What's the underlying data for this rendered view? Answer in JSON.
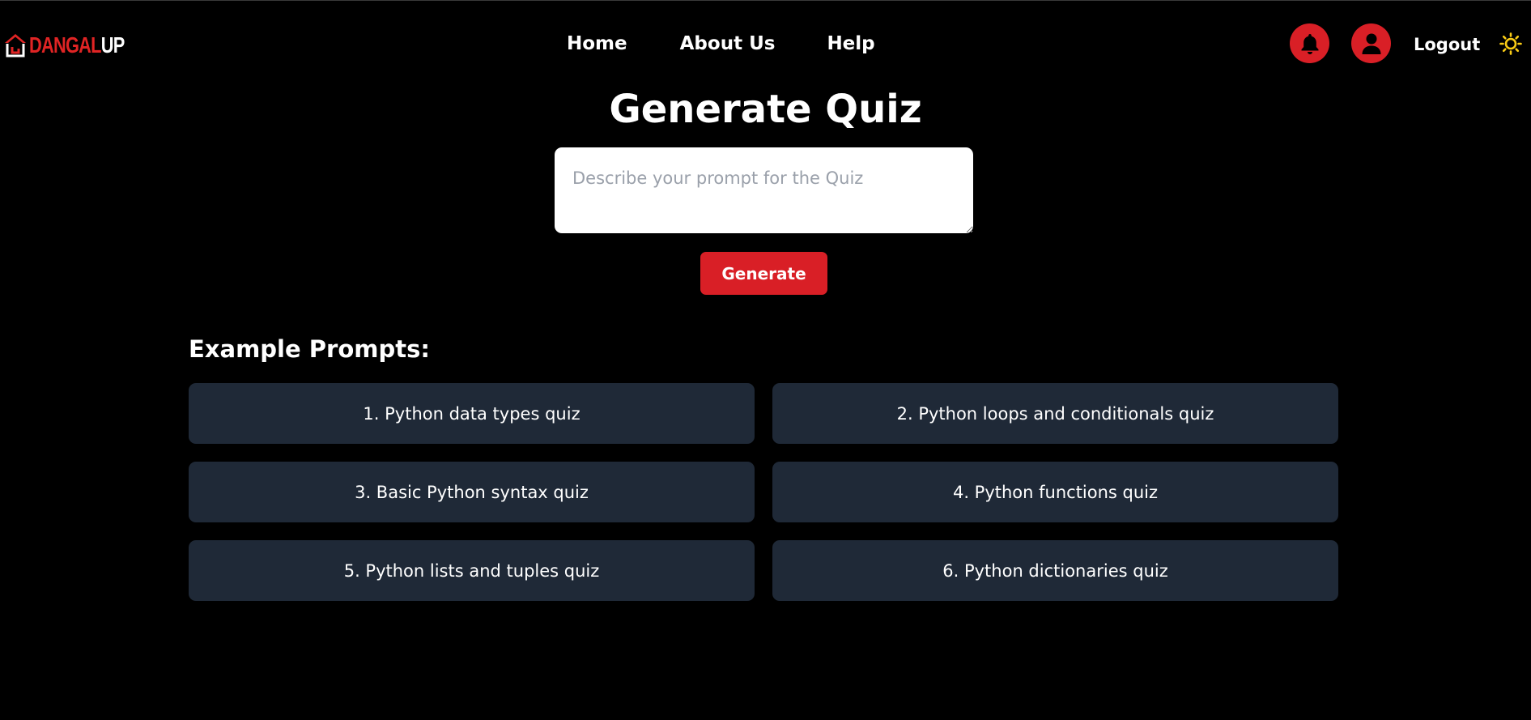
{
  "brand": {
    "logo_part1": "DANGAL",
    "logo_part2": "UP",
    "accent_color": "#d91f26"
  },
  "nav": {
    "home": "Home",
    "about": "About Us",
    "help": "Help"
  },
  "header_actions": {
    "bell_icon": "bell-icon",
    "user_icon": "user-icon",
    "logout": "Logout",
    "theme_icon": "sun-icon"
  },
  "main": {
    "title": "Generate Quiz",
    "prompt_placeholder": "Describe your prompt for the Quiz",
    "prompt_value": "",
    "generate_label": "Generate"
  },
  "examples": {
    "heading": "Example Prompts:",
    "items": [
      {
        "label": "1. Python data types quiz"
      },
      {
        "label": "2. Python loops and conditionals quiz"
      },
      {
        "label": "3. Basic Python syntax quiz"
      },
      {
        "label": "4. Python functions quiz"
      },
      {
        "label": "5. Python lists and tuples quiz"
      },
      {
        "label": "6. Python dictionaries quiz"
      }
    ]
  },
  "colors": {
    "background": "#000000",
    "card": "#1f2937",
    "sun": "#facc15"
  }
}
